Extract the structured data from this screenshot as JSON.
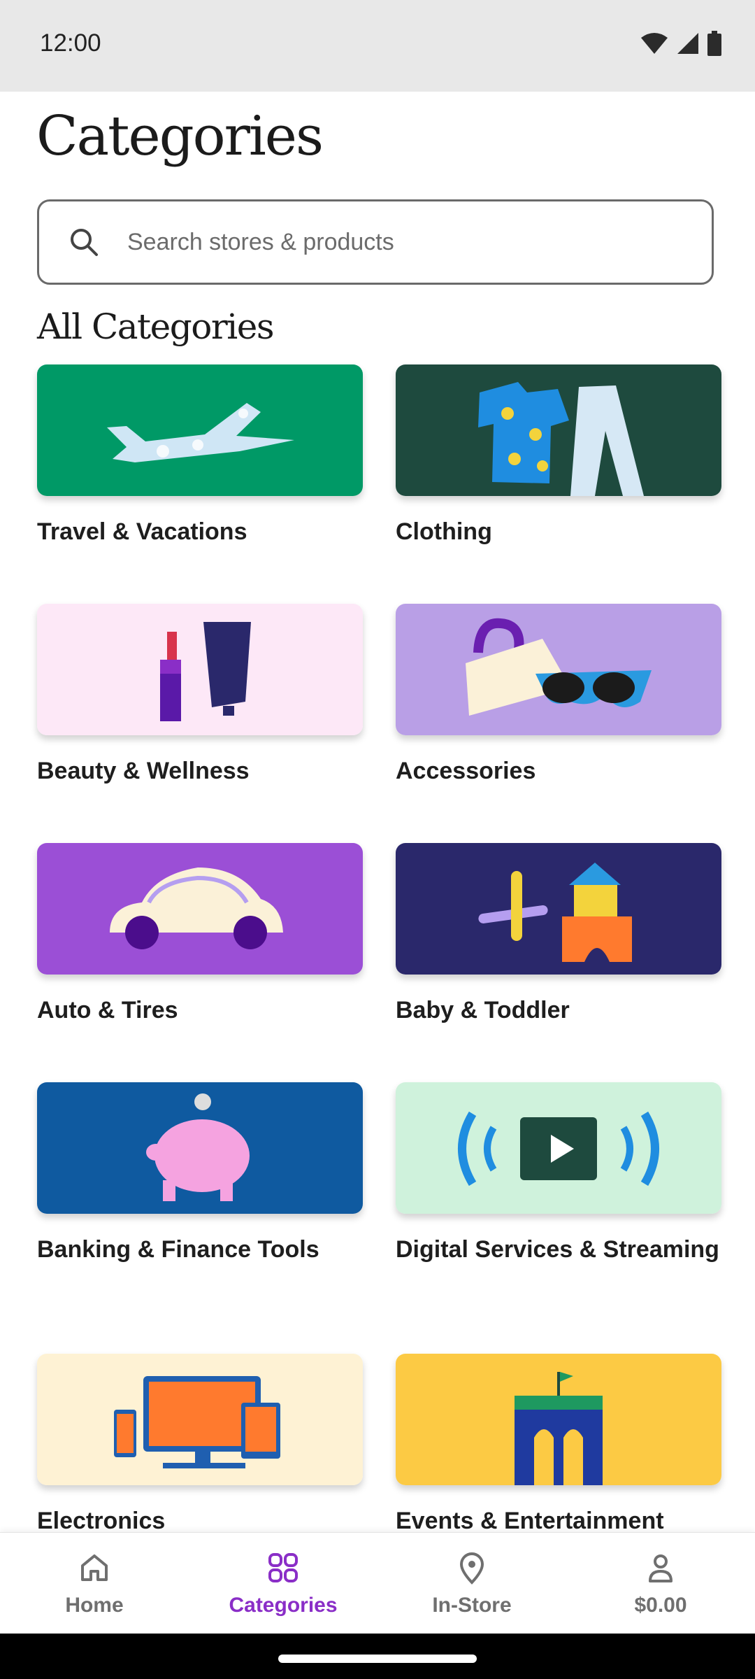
{
  "status_bar": {
    "time": "12:00"
  },
  "header": {
    "title": "Categories"
  },
  "search": {
    "placeholder": "Search stores & products"
  },
  "section": {
    "title": "All Categories"
  },
  "categories": [
    {
      "label": "Travel & Vacations",
      "tile_color": "#009966"
    },
    {
      "label": "Clothing",
      "tile_color": "#1e4a3e"
    },
    {
      "label": "Beauty & Wellness",
      "tile_color": "#fde8f7"
    },
    {
      "label": "Accessories",
      "tile_color": "#b99fe6"
    },
    {
      "label": "Auto & Tires",
      "tile_color": "#9b4fd6"
    },
    {
      "label": "Baby & Toddler",
      "tile_color": "#2a286b"
    },
    {
      "label": "Banking & Finance Tools",
      "tile_color": "#0f5aa0"
    },
    {
      "label": "Digital Services & Streaming",
      "tile_color": "#cff2dc"
    },
    {
      "label": "Electronics",
      "tile_color": "#fef2d4"
    },
    {
      "label": "Events & Entertainment",
      "tile_color": "#fcca44"
    }
  ],
  "bottom_nav": {
    "items": [
      {
        "label": "Home",
        "icon": "home-icon"
      },
      {
        "label": "Categories",
        "icon": "grid-icon",
        "active": true
      },
      {
        "label": "In-Store",
        "icon": "location-pin-icon"
      },
      {
        "label": "$0.00",
        "icon": "account-icon"
      }
    ],
    "active_color": "#8a2ec7"
  }
}
